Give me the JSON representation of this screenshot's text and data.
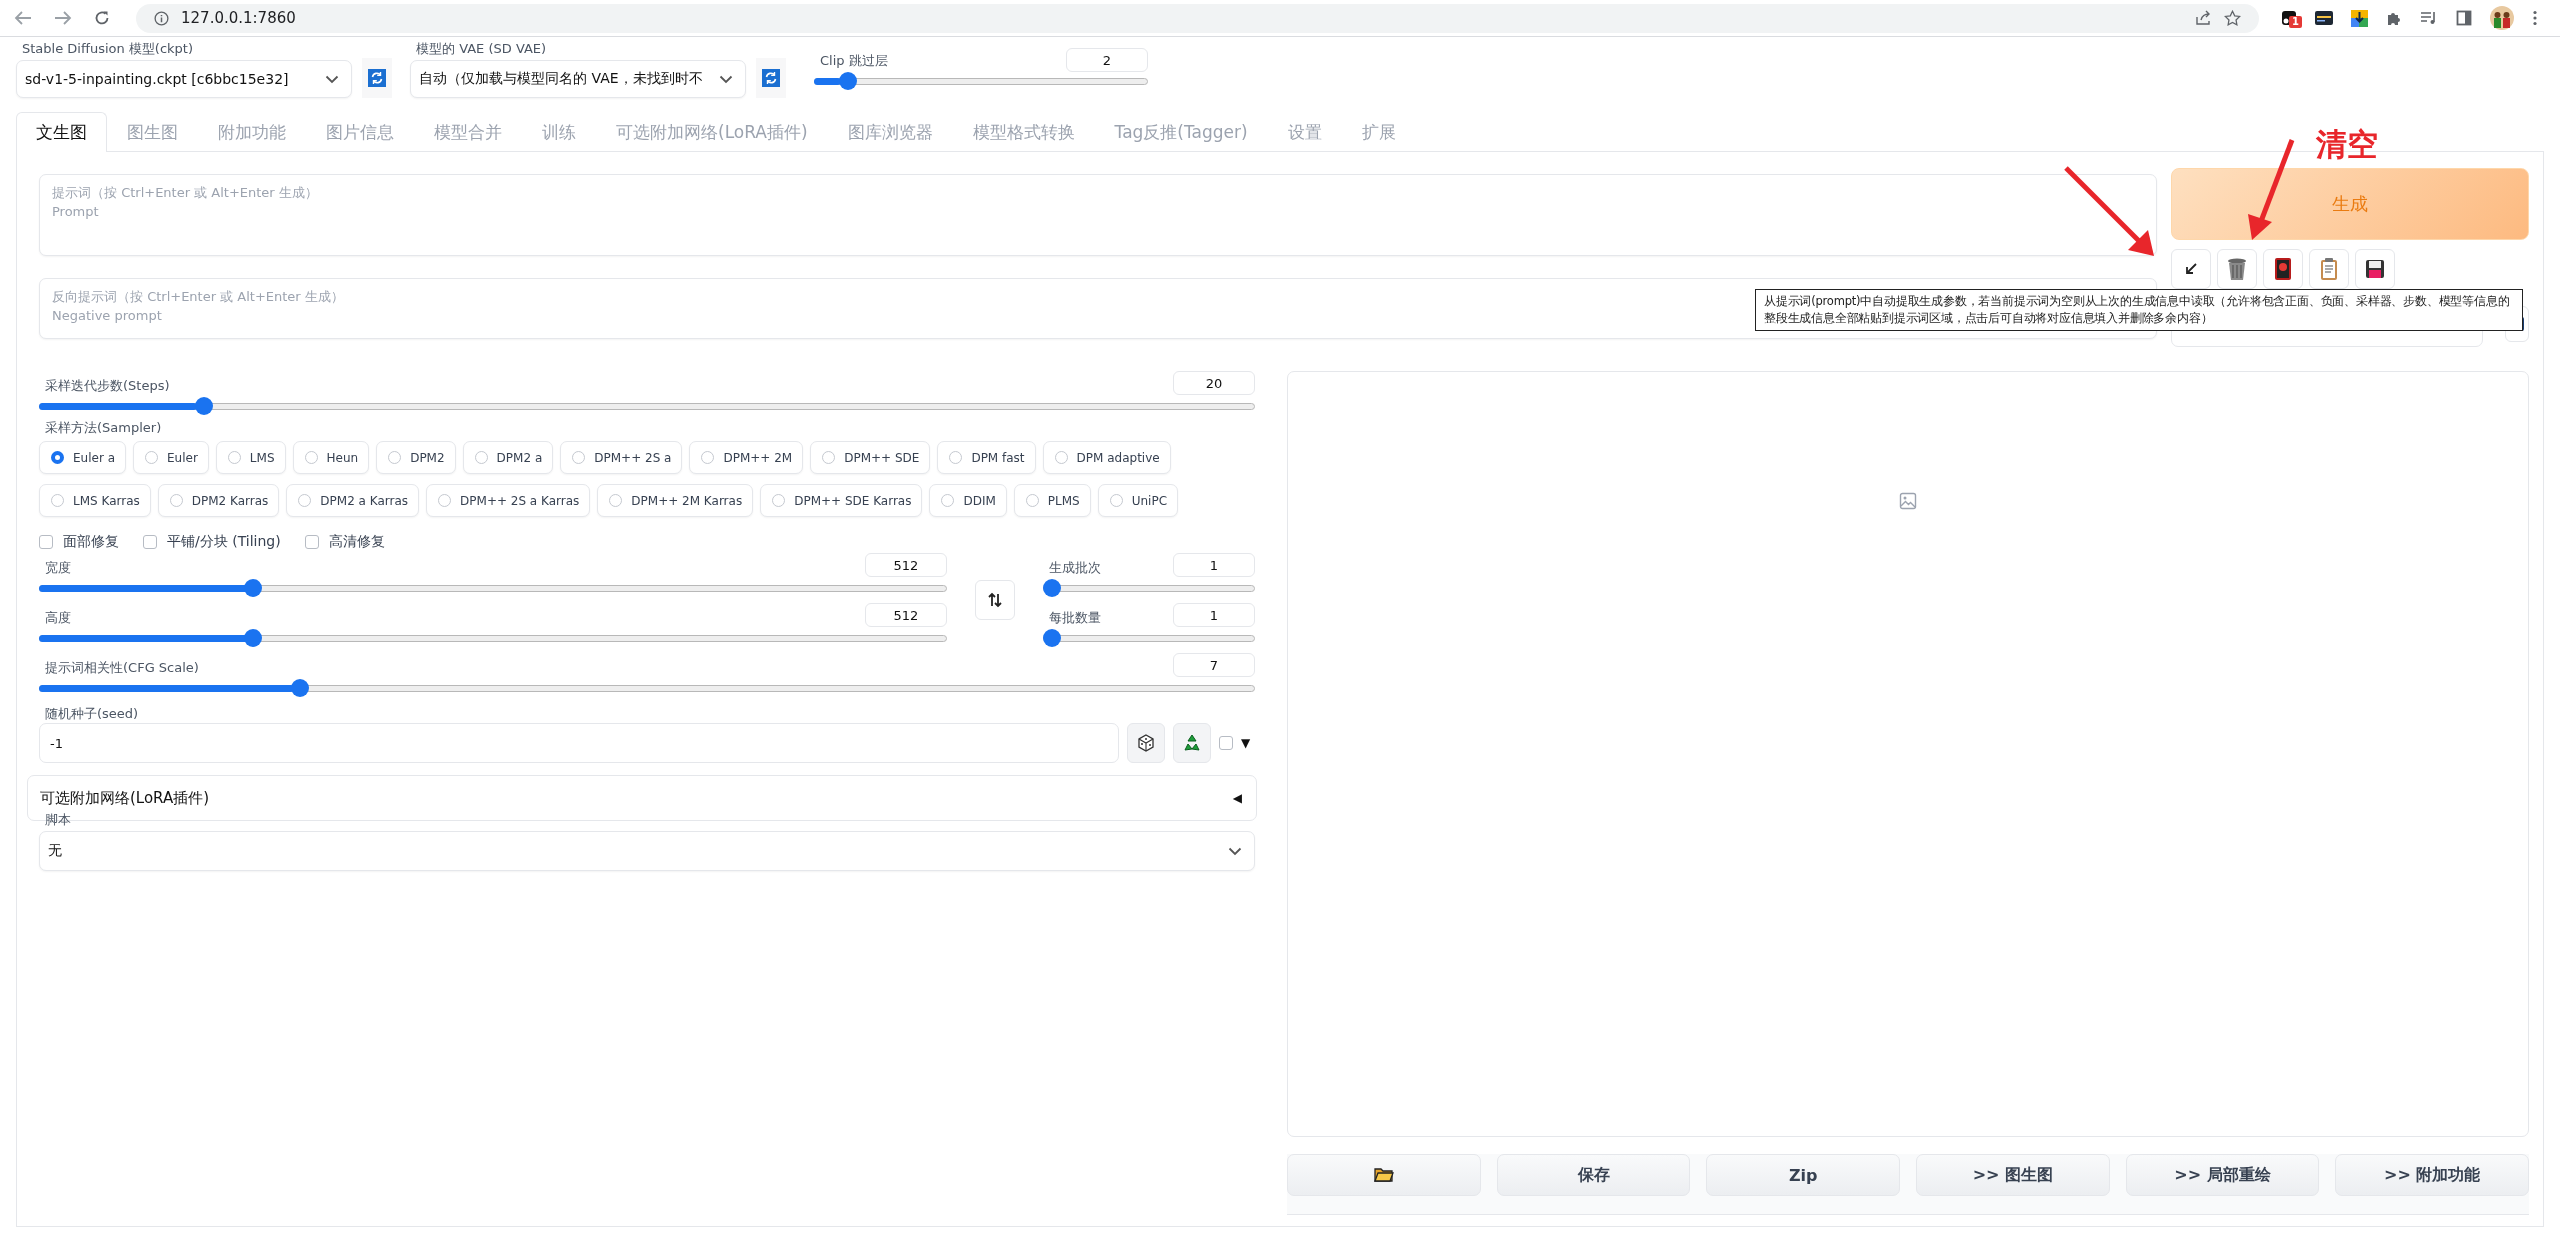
{
  "browser": {
    "url": "127.0.0.1:7860",
    "extension_badge": "1"
  },
  "settings": {
    "model": {
      "label": "Stable Diffusion 模型(ckpt)",
      "value": "sd-v1-5-inpainting.ckpt [c6bbc15e32]"
    },
    "vae": {
      "label": "模型的 VAE (SD VAE)",
      "value": "自动（仅加载与模型同名的 VAE，未找到时不"
    },
    "clip_skip": {
      "label": "Clip 跳过层",
      "value": "2",
      "level": 0.08
    }
  },
  "tabs": [
    {
      "label": "文生图",
      "selected": true
    },
    {
      "label": "图生图",
      "selected": false
    },
    {
      "label": "附加功能",
      "selected": false
    },
    {
      "label": "图片信息",
      "selected": false
    },
    {
      "label": "模型合并",
      "selected": false
    },
    {
      "label": "训练",
      "selected": false
    },
    {
      "label": "可选附加网络(LoRA插件)",
      "selected": false
    },
    {
      "label": "图库浏览器",
      "selected": false
    },
    {
      "label": "模型格式转换",
      "selected": false
    },
    {
      "label": "Tag反推(Tagger)",
      "selected": false
    },
    {
      "label": "设置",
      "selected": false
    },
    {
      "label": "扩展",
      "selected": false
    }
  ],
  "prompt": {
    "placeholder": "提示词（按 Ctrl+Enter 或 Alt+Enter 生成）\nPrompt"
  },
  "negative_prompt": {
    "placeholder": "反向提示词（按 Ctrl+Enter 或 Alt+Enter 生成）\nNegative prompt"
  },
  "generate_button": "生成",
  "tooltip": "从提示词(prompt)中自动提取生成参数，若当前提示词为空则从上次的生成信息中读取（允许将包含正面、负面、采样器、步数、模型等信息的整段生成信息全部粘贴到提示词区域，点击后可自动将对应信息填入并删除多余内容）",
  "annotation": {
    "text": "清空"
  },
  "steps": {
    "label": "采样迭代步数(Steps)",
    "value": "20",
    "level": 0.13
  },
  "sampler": {
    "label": "采样方法(Sampler)",
    "options": [
      {
        "label": "Euler a",
        "selected": true
      },
      {
        "label": "Euler",
        "selected": false
      },
      {
        "label": "LMS",
        "selected": false
      },
      {
        "label": "Heun",
        "selected": false
      },
      {
        "label": "DPM2",
        "selected": false
      },
      {
        "label": "DPM2 a",
        "selected": false
      },
      {
        "label": "DPM++ 2S a",
        "selected": false
      },
      {
        "label": "DPM++ 2M",
        "selected": false
      },
      {
        "label": "DPM++ SDE",
        "selected": false
      },
      {
        "label": "DPM fast",
        "selected": false
      },
      {
        "label": "DPM adaptive",
        "selected": false
      },
      {
        "label": "LMS Karras",
        "selected": false
      },
      {
        "label": "DPM2 Karras",
        "selected": false
      },
      {
        "label": "DPM2 a Karras",
        "selected": false
      },
      {
        "label": "DPM++ 2S a Karras",
        "selected": false
      },
      {
        "label": "DPM++ 2M Karras",
        "selected": false
      },
      {
        "label": "DPM++ SDE Karras",
        "selected": false
      },
      {
        "label": "DDIM",
        "selected": false
      },
      {
        "label": "PLMS",
        "selected": false
      },
      {
        "label": "UniPC",
        "selected": false
      }
    ]
  },
  "options": [
    {
      "label": "面部修复",
      "checked": false
    },
    {
      "label": "平铺/分块 (Tiling)",
      "checked": false
    },
    {
      "label": "高清修复",
      "checked": false
    }
  ],
  "width": {
    "label": "宽度",
    "value": "512",
    "level": 0.23
  },
  "height": {
    "label": "高度",
    "value": "512",
    "level": 0.23
  },
  "batch_count": {
    "label": "生成批次",
    "value": "1",
    "level": 0
  },
  "batch_size": {
    "label": "每批数量",
    "value": "1",
    "level": 0
  },
  "cfg_scale": {
    "label": "提示词相关性(CFG Scale)",
    "value": "7",
    "level": 0.21
  },
  "seed": {
    "label": "随机种子(seed)",
    "value": "-1",
    "extra_checked": false,
    "toggle": "▼"
  },
  "lora_accordion": {
    "title": "可选附加网络(LoRA插件)",
    "toggle": "◀"
  },
  "script": {
    "label": "脚本",
    "value": "无"
  },
  "output_buttons": [
    {
      "kind": "folder"
    },
    {
      "kind": "text",
      "label": "保存"
    },
    {
      "kind": "text",
      "label": "Zip"
    },
    {
      "kind": "text",
      "label": ">> 图生图"
    },
    {
      "kind": "text",
      "label": ">> 局部重绘"
    },
    {
      "kind": "text",
      "label": ">> 附加功能"
    }
  ]
}
